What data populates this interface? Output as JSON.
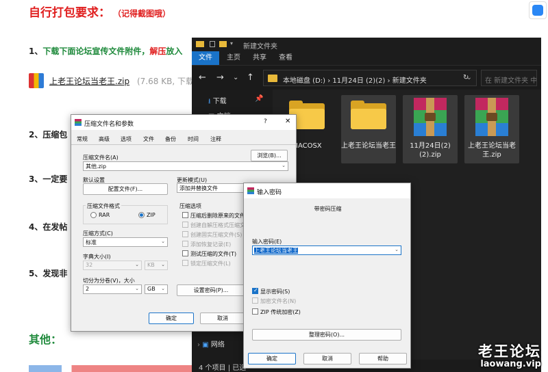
{
  "forum": {
    "title": "自行打包要求：",
    "title_note": "（记得截图哦）",
    "step1_prefix": "1、",
    "step1_green": "下载下面论坛宣传文件附件，",
    "step1_red": "解压",
    "step1_rest": "放入",
    "attachment_name": "上老王论坛当老王.zip",
    "attachment_meta": "(7.68 KB, 下载",
    "step2": "2、压缩包",
    "step3": "3、一定要",
    "step4": "4、在发帖",
    "step5": "5、发现非",
    "other": "其他："
  },
  "watermark": {
    "cn": "老王论坛",
    "url": "laowang.vip"
  },
  "explorer": {
    "title": "新建文件夹",
    "ribbon_tabs": [
      "文件",
      "主页",
      "共享",
      "查看"
    ],
    "address": "本地磁盘 (D:)  ›  11月24日 (2)(2)  ›  新建文件夹",
    "search_placeholder": "在 新建文件夹 中搜索",
    "sidebar": [
      "下载",
      "文档",
      "网络"
    ],
    "files": [
      {
        "name": "MACOSX",
        "type": "folder"
      },
      {
        "name": "上老王论坛当老王",
        "type": "folder"
      },
      {
        "name": "11月24日(2)(2).zip",
        "type": "zip"
      },
      {
        "name": "上老王论坛当老王.zip",
        "type": "zip"
      }
    ],
    "status": "4 个项目  |  已选"
  },
  "archive_dialog": {
    "title": "压缩文件名和参数",
    "help": "?",
    "close": "✕",
    "tabs": [
      "常规",
      "高级",
      "选项",
      "文件",
      "备份",
      "时间",
      "注释"
    ],
    "archive_name_label": "压缩文件名(A)",
    "archive_name_value": "其他.zip",
    "browse": "浏览(B)...",
    "default_settings_label": "默认设置",
    "profiles_button": "配置文件(F)...",
    "update_mode_label": "更新模式(U)",
    "update_mode_value": "添加并替换文件",
    "format_label": "压缩文件格式",
    "format_rar": "RAR",
    "format_zip": "ZIP",
    "options_label": "压缩选项",
    "options": [
      {
        "label": "压缩后删除原来的文件",
        "disabled": false
      },
      {
        "label": "创建自解压格式压缩文件",
        "disabled": true
      },
      {
        "label": "创建固实压缩文件(S)",
        "disabled": true
      },
      {
        "label": "添加恢复记录(E)",
        "disabled": true
      },
      {
        "label": "测试压缩的文件(T)",
        "disabled": false
      },
      {
        "label": "锁定压缩文件(L)",
        "disabled": true
      }
    ],
    "method_label": "压缩方式(C)",
    "method_value": "标准",
    "dict_label": "字典大小(I)",
    "dict_value": "32",
    "dict_unit": "KB",
    "split_label": "切分为分卷(V)，大小",
    "split_value": "2",
    "split_unit": "GB",
    "set_password": "设置密码(P)...",
    "ok": "确定",
    "cancel": "取消"
  },
  "password_dialog": {
    "title": "输入密码",
    "heading": "带密码压缩",
    "enter_label": "输入密码(E)",
    "password_value": "上老王论坛当老王",
    "show_password": "显示密码(S)",
    "encrypt_names": "加密文件名(N)",
    "zip_legacy": "ZIP 传统加密(Z)",
    "organize": "整理密码(O)...",
    "ok": "确定",
    "cancel": "取消",
    "help": "帮助"
  }
}
